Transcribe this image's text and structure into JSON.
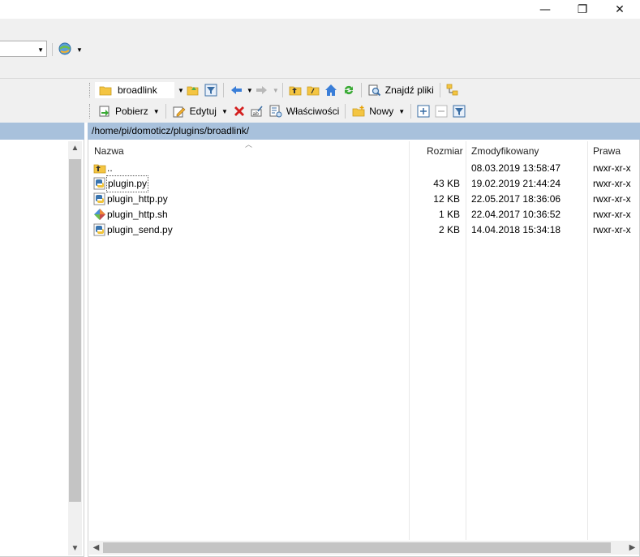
{
  "window": {
    "minimize_glyph": "—",
    "restore_glyph": "❐",
    "close_glyph": "✕"
  },
  "right_toolbar": {
    "path_combo": "broadlink",
    "find_files": "Znajdź pliki",
    "download": "Pobierz",
    "edit": "Edytuj",
    "properties": "Właściwości",
    "new": "Nowy"
  },
  "remote_path": "/home/pi/domoticz/plugins/broadlink/",
  "columns": {
    "name": "Nazwa",
    "size": "Rozmiar",
    "modified": "Zmodyfikowany",
    "rights": "Prawa"
  },
  "files": [
    {
      "name": "..",
      "size": "",
      "modified": "08.03.2019 13:58:47",
      "rights": "rwxr-xr-x",
      "icon": "parent-folder-icon"
    },
    {
      "name": "plugin.py",
      "size": "43 KB",
      "modified": "19.02.2019 21:44:24",
      "rights": "rwxr-xr-x",
      "icon": "python-file-icon"
    },
    {
      "name": "plugin_http.py",
      "size": "12 KB",
      "modified": "22.05.2017 18:36:06",
      "rights": "rwxr-xr-x",
      "icon": "python-file-icon"
    },
    {
      "name": "plugin_http.sh",
      "size": "1 KB",
      "modified": "22.04.2017 10:36:52",
      "rights": "rwxr-xr-x",
      "icon": "shell-script-icon"
    },
    {
      "name": "plugin_send.py",
      "size": "2 KB",
      "modified": "14.04.2018 15:34:18",
      "rights": "rwxr-xr-x",
      "icon": "python-file-icon"
    }
  ],
  "colors": {
    "path_bar": "#a8c1dc",
    "toolbar_bg": "#f0f0f0",
    "delete_red": "#d42020",
    "folder_yellow": "#f4c542"
  }
}
